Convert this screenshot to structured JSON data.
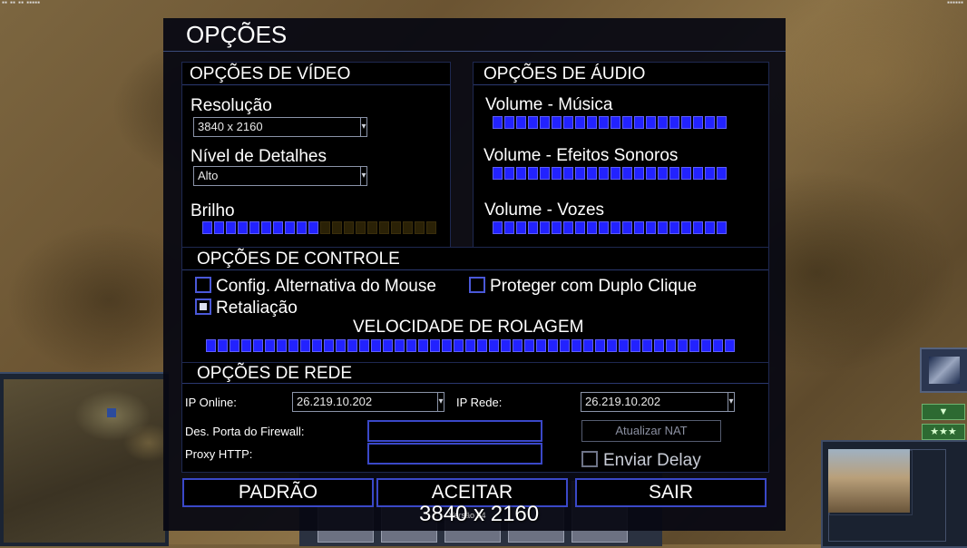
{
  "dialog": {
    "title": "OPÇÕES",
    "video": {
      "header": "OPÇÕES DE VÍDEO",
      "resolution_label": "Resolução",
      "resolution_value": "3840 x 2160",
      "detail_label": "Nível de Detalhes",
      "detail_value": "Alto",
      "brightness_label": "Brilho",
      "brightness_level": 0.5
    },
    "audio": {
      "header": "OPÇÕES DE ÁUDIO",
      "music_label": "Volume - Música",
      "music_level": 1.0,
      "sfx_label": "Volume - Efeitos Sonoros",
      "sfx_level": 1.0,
      "voice_label": "Volume - Vozes",
      "voice_level": 1.0
    },
    "control": {
      "header": "OPÇÕES DE CONTROLE",
      "alt_mouse_label": "Config. Alternativa do Mouse",
      "alt_mouse_checked": false,
      "double_click_label": "Proteger com Duplo Clique",
      "double_click_checked": false,
      "retaliation_label": "Retaliação",
      "retaliation_checked": true,
      "scroll_speed_label": "VELOCIDADE DE ROLAGEM",
      "scroll_speed_level": 1.0
    },
    "network": {
      "header": "OPÇÕES DE REDE",
      "online_ip_label": "IP Online:",
      "online_ip_value": "26.219.10.202",
      "lan_ip_label": "IP Rede:",
      "lan_ip_value": "26.219.10.202",
      "firewall_port_label": "Des. Porta do Firewall:",
      "firewall_port_value": "",
      "proxy_label": "Proxy HTTP:",
      "proxy_value": "",
      "refresh_nat_label": "Atualizar NAT",
      "send_delay_label": "Enviar Delay",
      "send_delay_checked": false
    },
    "buttons": {
      "default": "PADRÃO",
      "accept": "ACEITAR",
      "exit": "SAIR"
    }
  },
  "overlay": {
    "resolution_text": "3840 x 2160",
    "version_text": "Versão 04"
  },
  "colors": {
    "slider_on": "#2222ff",
    "slider_off": "#2a2106",
    "button_border": "#3a48c8"
  }
}
